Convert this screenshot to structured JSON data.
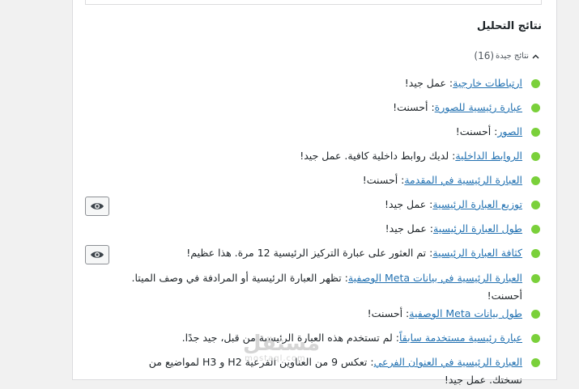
{
  "section_title": "نتائج التحليل",
  "good_results": {
    "label": "نتائج جيدة",
    "count": "(16)"
  },
  "results": [
    {
      "link": "ارتباطات خارجية",
      "text": ": عمل جيد!"
    },
    {
      "link": "عبارة رئيسية للصورة",
      "text": ": أحسنت!"
    },
    {
      "link": "الصور",
      "text": ": أحسنت!"
    },
    {
      "link": "الروابط الداخلية",
      "text": ": لديك روابط داخلية كافية. عمل جيد!"
    },
    {
      "link": "العبارة الرئيسية في المقدمة",
      "text": ": أحسنت!"
    },
    {
      "link": "توزيع العبارة الرئيسية",
      "text": ": عمل جيد!"
    },
    {
      "link": "طول العبارة الرئيسية",
      "text": ": عمل جيد!"
    },
    {
      "link": "كثافة العبارة الرئيسية",
      "text": ": تم العثور على عبارة التركيز الرئيسية 12 مرة. هذا عظيم!"
    },
    {
      "link": "العبارة الرئيسية في بيانات Meta الوصفية",
      "text": ": تظهر العبارة الرئيسية أو المرادفة في وصف الميتا. أحسنت!"
    },
    {
      "link": "طول بيانات Meta الوصفية",
      "text": ": أحسنت!"
    },
    {
      "link": "عبارة رئيسية مستخدمة سابقاً",
      "text": ": لم تستخدم هذه العبارة الرئيسية من قبل، جيد جدًا."
    },
    {
      "link": "العبارة الرئيسية في العنوان الفرعي",
      "text": ": تعكس 9 من العناوين الفرعية H2 و H3 لمواضيع من نسختك. عمل جيد!"
    }
  ],
  "watermark": {
    "arabic": "مستقل",
    "latin": "mostaql.com"
  },
  "colors": {
    "good": "#7ad03a",
    "link": "#2271b1"
  },
  "icons": {
    "toggle": "chevron-up-icon",
    "eye": "eye-icon"
  }
}
